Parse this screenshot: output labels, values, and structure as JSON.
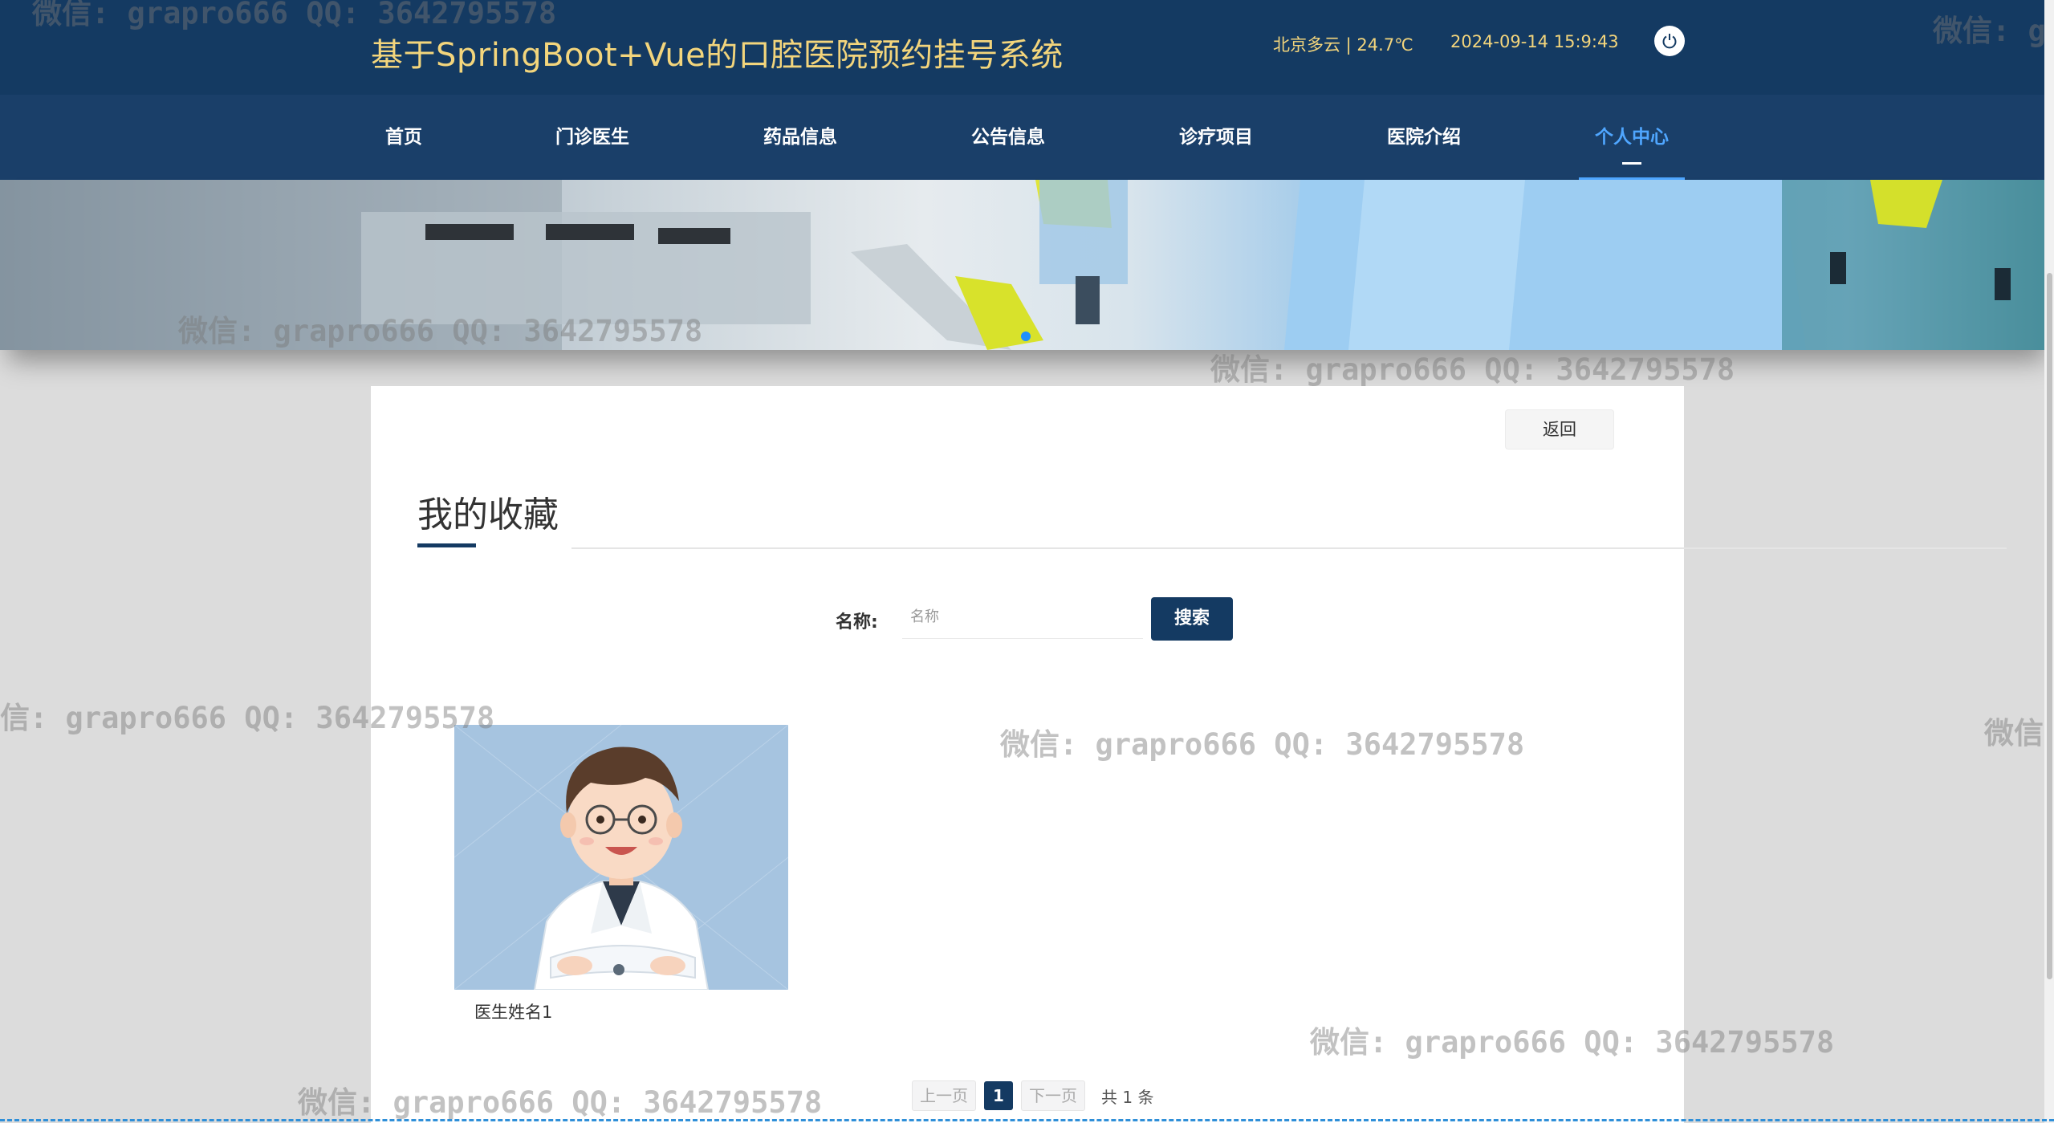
{
  "header": {
    "site_title": "基于SpringBoot+Vue的口腔医院预约挂号系统",
    "weather": "北京多云 | 24.7℃",
    "datetime": "2024-09-14   15:9:43",
    "power_icon": "power-icon"
  },
  "nav": {
    "items": [
      {
        "label": "首页",
        "active": false
      },
      {
        "label": "门诊医生",
        "active": false
      },
      {
        "label": "药品信息",
        "active": false
      },
      {
        "label": "公告信息",
        "active": false
      },
      {
        "label": "诊疗项目",
        "active": false
      },
      {
        "label": "医院介绍",
        "active": false
      },
      {
        "label": "个人中心",
        "active": true
      }
    ]
  },
  "banner": {
    "dot_count": 1,
    "active_dot": 0
  },
  "page": {
    "back_label": "返回",
    "title": "我的收藏",
    "search_label": "名称:",
    "search_placeholder": "名称",
    "search_value": "",
    "search_button": "搜索"
  },
  "favorites": [
    {
      "name": "医生姓名1"
    }
  ],
  "pagination": {
    "prev_label": "上一页",
    "current_page": "1",
    "next_label": "下一页",
    "total_text": "共 1 条"
  },
  "watermark_text": "微信: grapro666 QQ: 3642795578",
  "watermark_clipped": "微信: g",
  "watermark_left_clipped": "信: grapro666 QQ: 3642795578",
  "watermark_right_clipped": "微信",
  "colors": {
    "header_bg": "#143a62",
    "nav_bg": "#1a3f69",
    "title_gold": "#f3d57c",
    "nav_active": "#4fa6ff",
    "primary_button": "#143a62"
  }
}
